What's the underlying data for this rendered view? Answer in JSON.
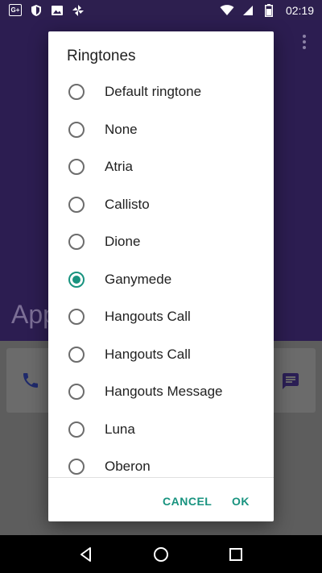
{
  "status_bar": {
    "time": "02:19",
    "left_icons": [
      "google-plus-icon",
      "shield-icon",
      "image-icon",
      "pinwheel-icon"
    ],
    "right_icons": [
      "wifi-icon",
      "signal-icon",
      "battery-icon"
    ]
  },
  "background_app": {
    "title_partial": "App"
  },
  "dialog": {
    "title": "Ringtones",
    "options": [
      {
        "label": "Default ringtone",
        "selected": false
      },
      {
        "label": "None",
        "selected": false
      },
      {
        "label": "Atria",
        "selected": false
      },
      {
        "label": "Callisto",
        "selected": false
      },
      {
        "label": "Dione",
        "selected": false
      },
      {
        "label": "Ganymede",
        "selected": true
      },
      {
        "label": "Hangouts Call",
        "selected": false
      },
      {
        "label": "Hangouts Call",
        "selected": false
      },
      {
        "label": "Hangouts Message",
        "selected": false
      },
      {
        "label": "Luna",
        "selected": false
      },
      {
        "label": "Oberon",
        "selected": false
      }
    ],
    "cancel_label": "CANCEL",
    "ok_label": "OK",
    "accent_color": "#18937f"
  },
  "nav_bar": {
    "buttons": [
      "back-icon",
      "home-icon",
      "recents-icon"
    ]
  }
}
